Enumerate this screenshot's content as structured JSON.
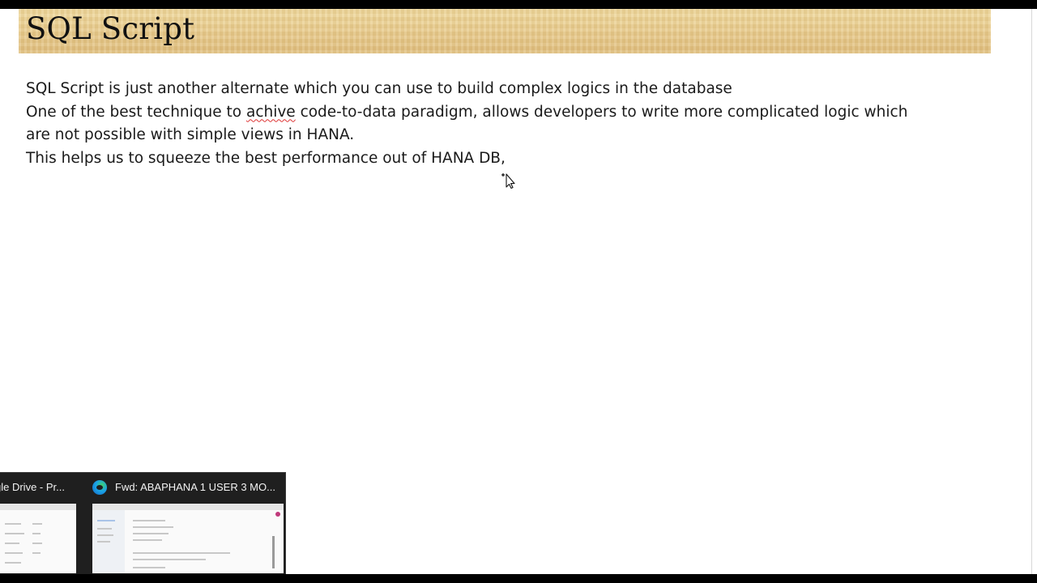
{
  "slide": {
    "title": "SQL Script",
    "lines": [
      "SQL Script is just another alternate which you can use to build complex logics in the database",
      "are not possible with simple views in HANA.",
      "This helps us to squeeze the best performance out of HANA DB,"
    ],
    "line2": {
      "before": "One of the best technique to ",
      "misspelled_word": "achive",
      "after": " code-to-data paradigm,  allows developers to write more complicated logic which"
    }
  },
  "taskbar_preview": {
    "items": [
      {
        "title": "gle Drive - Pr...",
        "icon": ""
      },
      {
        "title": "Fwd: ABAPHANA 1 USER 3 MO...",
        "icon": "edge-browser-icon"
      }
    ]
  },
  "colors": {
    "banner": "#ecd292",
    "text": "#1a1a1a",
    "preview_bg": "#1f1f1f"
  }
}
